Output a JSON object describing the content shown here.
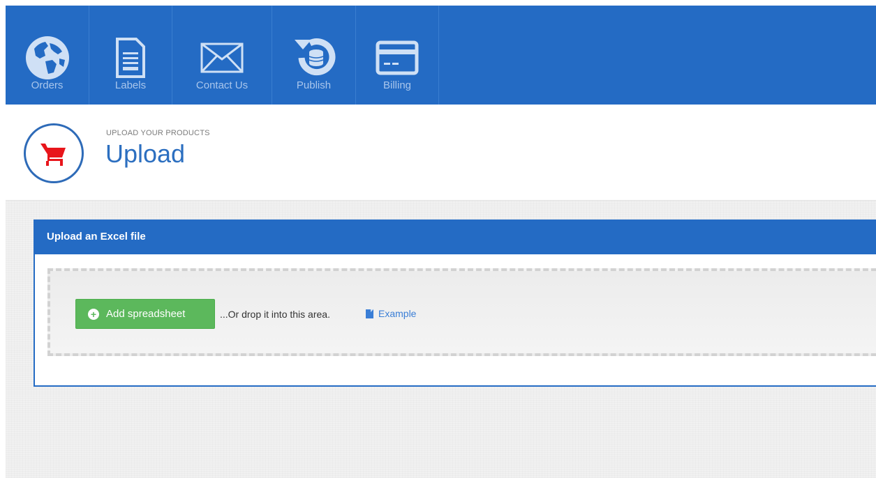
{
  "nav": {
    "items": [
      {
        "label": "Orders",
        "icon": "globe-icon"
      },
      {
        "label": "Labels",
        "icon": "document-icon"
      },
      {
        "label": "Contact Us",
        "icon": "envelope-icon"
      },
      {
        "label": "Publish",
        "icon": "database-sync-icon"
      },
      {
        "label": "Billing",
        "icon": "credit-card-icon"
      }
    ]
  },
  "header": {
    "subtitle": "UPLOAD YOUR PRODUCTS",
    "title": "Upload",
    "icon": "shopping-cart-icon"
  },
  "panel": {
    "title": "Upload an Excel file",
    "add_button": "Add spreadsheet",
    "drop_text": "...Or drop it into this area.",
    "example_link": "Example"
  },
  "colors": {
    "nav_bg": "#246bc4",
    "accent": "#2c6fc0",
    "success": "#5cb85c",
    "cart": "#e8151b"
  }
}
